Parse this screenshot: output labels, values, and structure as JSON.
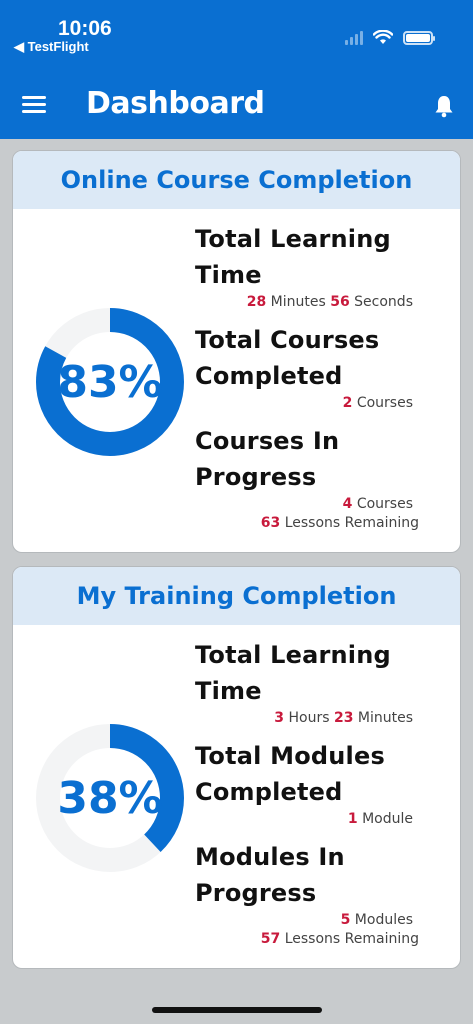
{
  "status_bar": {
    "time": "10:06",
    "back_app": "◀ TestFlight"
  },
  "header": {
    "title": "Dashboard"
  },
  "accent": "#0a6fd1",
  "highlight": "#c81a3c",
  "cards": [
    {
      "title": "Online Course Completion",
      "percent_label": "83%",
      "percent": 83,
      "stats": [
        {
          "title_line1": "Total Learning",
          "title_line2": "Time",
          "lines": [
            {
              "parts": [
                {
                  "v": "28",
                  "hl": true
                },
                {
                  "v": " Minutes ",
                  "hl": false
                },
                {
                  "v": "56",
                  "hl": true
                },
                {
                  "v": " Seconds",
                  "hl": false
                }
              ]
            }
          ]
        },
        {
          "title_line1": "Total Courses",
          "title_line2": "Completed",
          "lines": [
            {
              "parts": [
                {
                  "v": "2",
                  "hl": true
                },
                {
                  "v": " Courses",
                  "hl": false
                }
              ]
            }
          ]
        },
        {
          "title_line1": "Courses In",
          "title_line2": "Progress",
          "lines": [
            {
              "parts": [
                {
                  "v": "4",
                  "hl": true
                },
                {
                  "v": " Courses",
                  "hl": false
                }
              ]
            },
            {
              "parts": [
                {
                  "v": "63",
                  "hl": true
                },
                {
                  "v": " Lessons Remaining",
                  "hl": false
                }
              ]
            }
          ]
        }
      ]
    },
    {
      "title": "My Training Completion",
      "percent_label": "38%",
      "percent": 38,
      "stats": [
        {
          "title_line1": "Total Learning",
          "title_line2": "Time",
          "lines": [
            {
              "parts": [
                {
                  "v": "3",
                  "hl": true
                },
                {
                  "v": " Hours ",
                  "hl": false
                },
                {
                  "v": "23",
                  "hl": true
                },
                {
                  "v": " Minutes",
                  "hl": false
                }
              ]
            }
          ]
        },
        {
          "title_line1": "Total Modules",
          "title_line2": "Completed",
          "lines": [
            {
              "parts": [
                {
                  "v": "1",
                  "hl": true
                },
                {
                  "v": " Module",
                  "hl": false
                }
              ]
            }
          ]
        },
        {
          "title_line1": "Modules In",
          "title_line2": "Progress",
          "lines": [
            {
              "parts": [
                {
                  "v": "5",
                  "hl": true
                },
                {
                  "v": " Modules",
                  "hl": false
                }
              ]
            },
            {
              "parts": [
                {
                  "v": "57",
                  "hl": true
                },
                {
                  "v": " Lessons Remaining",
                  "hl": false
                }
              ]
            }
          ]
        }
      ]
    }
  ]
}
